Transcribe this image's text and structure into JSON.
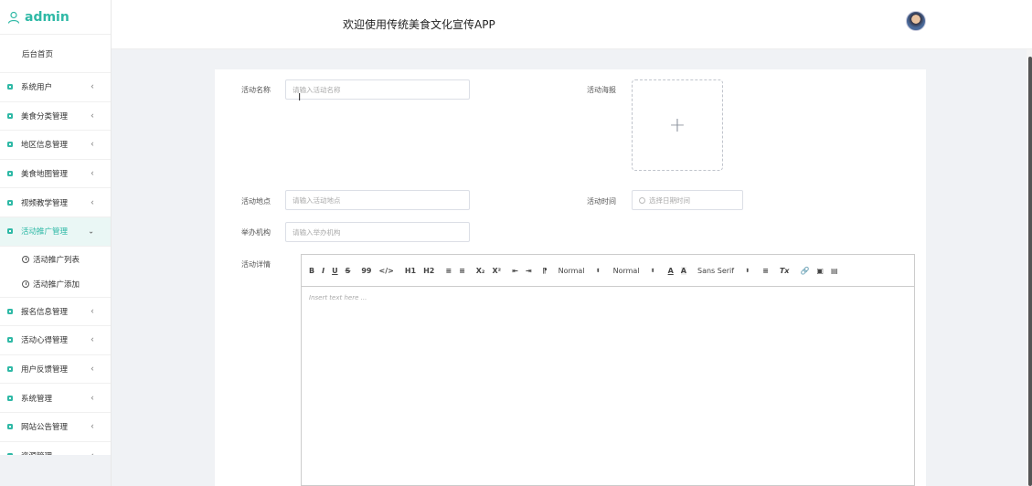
{
  "brand": {
    "title": "admin"
  },
  "header": {
    "title": "欢迎使用传统美食文化宣传APP"
  },
  "sidebar": {
    "home": "后台首页",
    "items": [
      {
        "label": "系统用户"
      },
      {
        "label": "美食分类管理"
      },
      {
        "label": "地区信息管理"
      },
      {
        "label": "美食地图管理"
      },
      {
        "label": "视频教学管理"
      },
      {
        "label": "活动推广管理",
        "active": true
      },
      {
        "label": "报名信息管理"
      },
      {
        "label": "活动心得管理"
      },
      {
        "label": "用户反馈管理"
      },
      {
        "label": "系统管理"
      },
      {
        "label": "网站公告管理"
      },
      {
        "label": "资源管理"
      }
    ],
    "subitems": [
      {
        "label": "活动推广列表"
      },
      {
        "label": "活动推广添加"
      }
    ]
  },
  "form": {
    "name_label": "活动名称",
    "name_placeholder": "请输入活动名称",
    "poster_label": "活动海报",
    "poster_plus": "+",
    "place_label": "活动地点",
    "place_placeholder": "请输入活动地点",
    "time_label": "活动时间",
    "time_placeholder": "选择日期时间",
    "org_label": "举办机构",
    "org_placeholder": "请输入举办机构",
    "detail_label": "活动详情"
  },
  "editor": {
    "bold": "B",
    "italic": "I",
    "underline": "U",
    "strike": "S",
    "quote": "99",
    "code": "</>",
    "h1": "H1",
    "h2": "H2",
    "ol": "≡",
    "ul": "≡",
    "sub": "X₂",
    "sup": "X²",
    "outdent": "⇤",
    "indent": "⇥",
    "direction": "⁋",
    "size_select": "Normal",
    "header_select": "Normal",
    "color": "A",
    "background": "A",
    "font_select": "Sans Serif",
    "align": "≡",
    "clean": "Tx",
    "link": "🔗",
    "image": "▣",
    "video": "▤",
    "placeholder": "Insert text here ..."
  },
  "colors": {
    "accent": "#2fb9a6"
  }
}
